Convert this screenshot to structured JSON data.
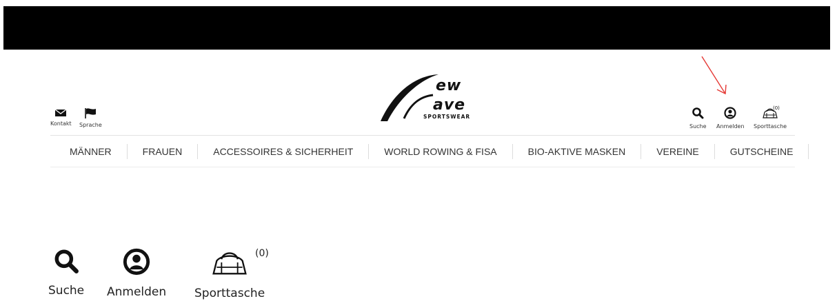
{
  "header": {
    "logo": {
      "line1": "ew",
      "line2": "ave",
      "sub": "SPORTSWEAR"
    },
    "left_icons": [
      {
        "label": "Kontakt",
        "icon": "envelope-icon"
      },
      {
        "label": "Sprache",
        "icon": "flag-icon"
      }
    ],
    "right_icons": [
      {
        "label": "Suche",
        "icon": "search-icon"
      },
      {
        "label": "Anmelden",
        "icon": "user-icon"
      },
      {
        "label": "Sporttasche",
        "icon": "bag-icon",
        "badge": "(0)"
      }
    ]
  },
  "nav": {
    "items": [
      "MÄNNER",
      "FRAUEN",
      "ACCESSOIRES & SICHERHEIT",
      "WORLD ROWING & FISA",
      "BIO-AKTIVE MASKEN",
      "VEREINE",
      "GUTSCHEINE"
    ]
  },
  "zoom": {
    "suche": "Suche",
    "anmelden": "Anmelden",
    "sporttasche": "Sporttasche",
    "badge": "(0)"
  },
  "colors": {
    "annotation": "#e53935",
    "text": "#222222"
  }
}
